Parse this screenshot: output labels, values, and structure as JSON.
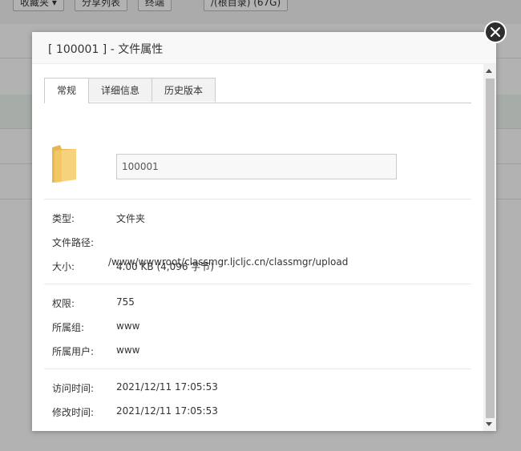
{
  "background": {
    "toolbar_buttons": [
      "收藏夹 ▾",
      "分享列表",
      "终端",
      "/(根目录) (67G)"
    ]
  },
  "dialog": {
    "title": "[ 100001 ] - 文件属性",
    "tabs": [
      {
        "label": "常规",
        "active": true
      },
      {
        "label": "详细信息",
        "active": false
      },
      {
        "label": "历史版本",
        "active": false
      }
    ],
    "file_name": "100001",
    "icon": "folder-icon",
    "general": {
      "type_label": "类型:",
      "type_value": "文件夹",
      "path_label": "文件路径:",
      "path_value": "/www/wwwroot/classmgr.ljcljc.cn/classmgr/upload",
      "size_label": "大小:",
      "size_value": "4.00 KB (4,096 字节)"
    },
    "permissions": {
      "perm_label": "权限:",
      "perm_value": "755",
      "group_label": "所属组:",
      "group_value": "www",
      "owner_label": "所属用户:",
      "owner_value": "www"
    },
    "times": {
      "access_label": "访问时间:",
      "access_value": "2021/12/11 17:05:53",
      "modify_label": "修改时间:",
      "modify_value": "2021/12/11 17:05:53"
    }
  },
  "colors": {
    "overlay": "#4d4d4d",
    "header_bg": "#f8f8f8",
    "close_button": "#2e2e2e",
    "folder": "#f5c96a"
  }
}
